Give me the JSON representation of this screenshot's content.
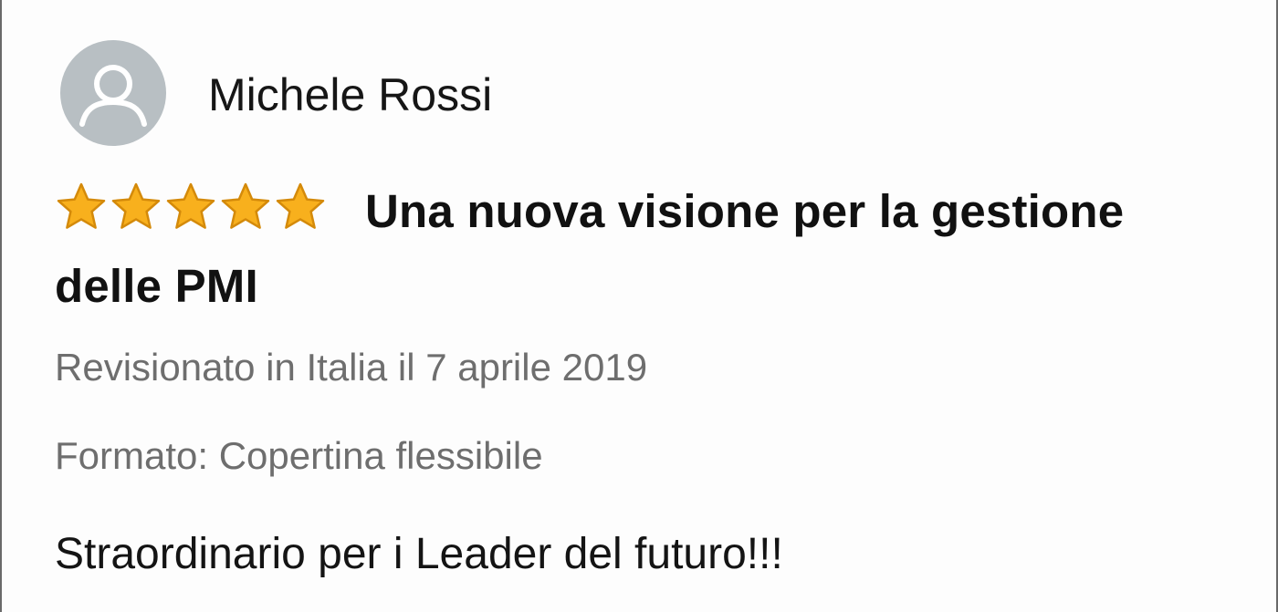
{
  "review": {
    "reviewer_name": "Michele Rossi",
    "rating": 5,
    "rating_max": 5,
    "title": "Una nuova visione per la gestione delle PMI",
    "review_date": "Revisionato in Italia il 7 aprile 2019",
    "format": "Formato: Copertina flessibile",
    "body": "Straordinario per i Leader del futuro!!!"
  },
  "icons": {
    "avatar": "default-user-avatar-icon",
    "star": "star-filled-icon"
  },
  "colors": {
    "star_fill": "#f8b01d",
    "star_outline": "#d48a0a",
    "avatar_bg": "#b8bfc3",
    "meta_text": "#6e6e6e"
  }
}
